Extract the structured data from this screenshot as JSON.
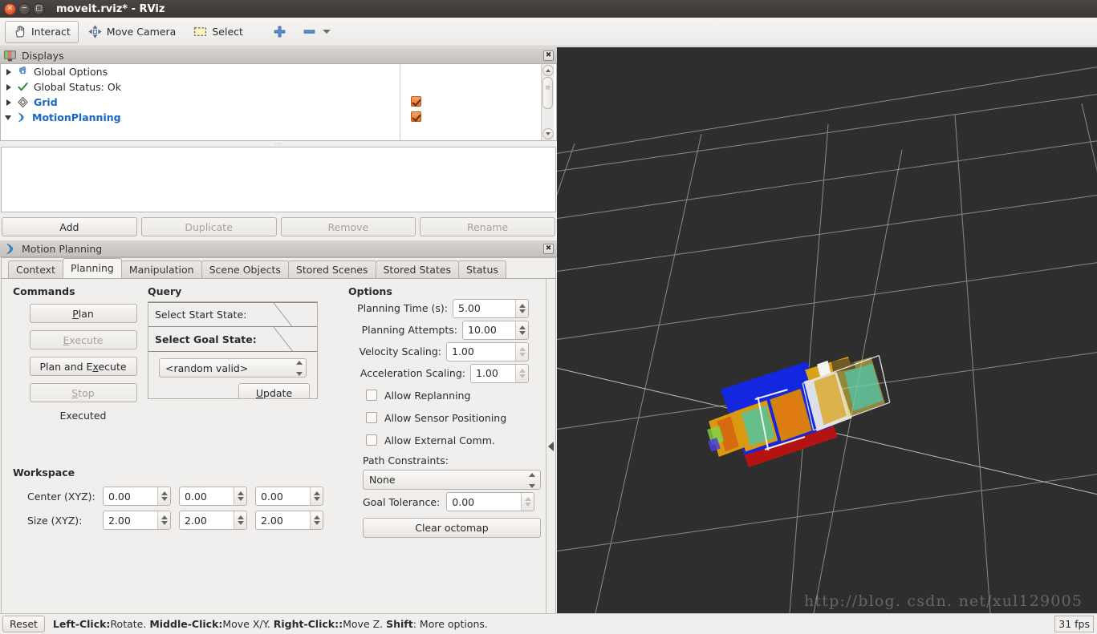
{
  "window": {
    "title": "moveit.rviz* - RViz",
    "close_glyph": "×",
    "minimize_glyph": "−",
    "maximize_glyph": "□"
  },
  "toolbar": {
    "items": [
      {
        "label": "Interact",
        "icon": "hand-cursor-icon",
        "active": true
      },
      {
        "label": "Move Camera",
        "icon": "move-camera-icon",
        "active": false
      },
      {
        "label": "Select",
        "icon": "select-marquee-icon",
        "active": false
      }
    ],
    "add_icon": "plus-icon",
    "remove_icon": "minus-icon",
    "dropdown_icon": "chevron-down-icon"
  },
  "displays": {
    "title": "Displays",
    "title_icon": "display-monitor-icon",
    "close_icon": "close-icon",
    "rows": [
      {
        "label": "Global Options",
        "icon": "gear-icon",
        "expander": "right",
        "bold": false,
        "checked": false
      },
      {
        "label": "Global Status: Ok",
        "icon": "checkmark-icon",
        "expander": "right",
        "bold": false,
        "checked": false
      },
      {
        "label": "Grid",
        "icon": "grid-icon",
        "expander": "right",
        "bold": true,
        "checked": true
      },
      {
        "label": "MotionPlanning",
        "icon": "motion-planning-icon",
        "expander": "down",
        "bold": true,
        "checked": true
      }
    ],
    "buttons": [
      {
        "label": "Add",
        "enabled": true
      },
      {
        "label": "Duplicate",
        "enabled": false
      },
      {
        "label": "Remove",
        "enabled": false
      },
      {
        "label": "Rename",
        "enabled": false
      }
    ]
  },
  "motion_planning": {
    "title": "Motion Planning",
    "title_icon": "motion-planning-icon",
    "close_icon": "close-icon",
    "tabs": [
      {
        "label": "Context",
        "selected": false
      },
      {
        "label": "Planning",
        "selected": true
      },
      {
        "label": "Manipulation",
        "selected": false
      },
      {
        "label": "Scene Objects",
        "selected": false
      },
      {
        "label": "Stored Scenes",
        "selected": false
      },
      {
        "label": "Stored States",
        "selected": false
      },
      {
        "label": "Status",
        "selected": false
      }
    ],
    "commands": {
      "title": "Commands",
      "buttons": [
        {
          "label": "Plan",
          "mnemonic": "P",
          "enabled": true
        },
        {
          "label": "Execute",
          "mnemonic": "E",
          "enabled": false
        },
        {
          "label": "Plan and Execute",
          "mnemonic": "x",
          "enabled": true
        },
        {
          "label": "Stop",
          "mnemonic": "S",
          "enabled": false
        }
      ],
      "status": "Executed"
    },
    "query": {
      "title": "Query",
      "start_state_label": "Select Start State:",
      "goal_state_label": "Select Goal State:",
      "goal_state_value": "<random valid>",
      "update_label": "Update",
      "update_mnemonic": "U"
    },
    "options": {
      "title": "Options",
      "fields": [
        {
          "label": "Planning Time (s):",
          "value": "5.00",
          "enabled": true
        },
        {
          "label": "Planning Attempts:",
          "value": "10.00",
          "enabled": true
        },
        {
          "label": "Velocity Scaling:",
          "value": "1.00",
          "enabled": false
        },
        {
          "label": "Acceleration Scaling:",
          "value": "1.00",
          "enabled": false
        }
      ],
      "checkboxes": [
        {
          "label": "Allow Replanning",
          "checked": false
        },
        {
          "label": "Allow Sensor Positioning",
          "checked": false
        },
        {
          "label": "Allow External Comm.",
          "checked": false
        }
      ],
      "path_constraints_label": "Path Constraints:",
      "path_constraints_value": "None",
      "goal_tolerance_label": "Goal Tolerance:",
      "goal_tolerance_value": "0.00",
      "clear_octomap_label": "Clear octomap"
    },
    "workspace": {
      "title": "Workspace",
      "rows": [
        {
          "label": "Center (XYZ):",
          "values": [
            "0.00",
            "0.00",
            "0.00"
          ]
        },
        {
          "label": "Size (XYZ):",
          "values": [
            "2.00",
            "2.00",
            "2.00"
          ]
        }
      ]
    },
    "collapse_icon": "chevron-left-icon"
  },
  "viewport": {
    "background_color": "#2e2e2e",
    "grid_color": "#9a9a9a",
    "watermark": "http://blog. csdn. net/xul129005"
  },
  "statusbar": {
    "reset_label": "Reset",
    "hints": [
      {
        "key": "Left-Click:",
        "text": " Rotate."
      },
      {
        "key": "Middle-Click:",
        "text": " Move X/Y."
      },
      {
        "key": "Right-Click::",
        "text": " Move Z."
      },
      {
        "key": "Shift",
        "text": ": More options."
      }
    ],
    "fps": "31 fps"
  },
  "colors": {
    "accent_blue": "#1667c7",
    "checkbox_orange": "#e8702a",
    "panel_bg": "#f0efee",
    "titlebar": "#3b3836"
  }
}
